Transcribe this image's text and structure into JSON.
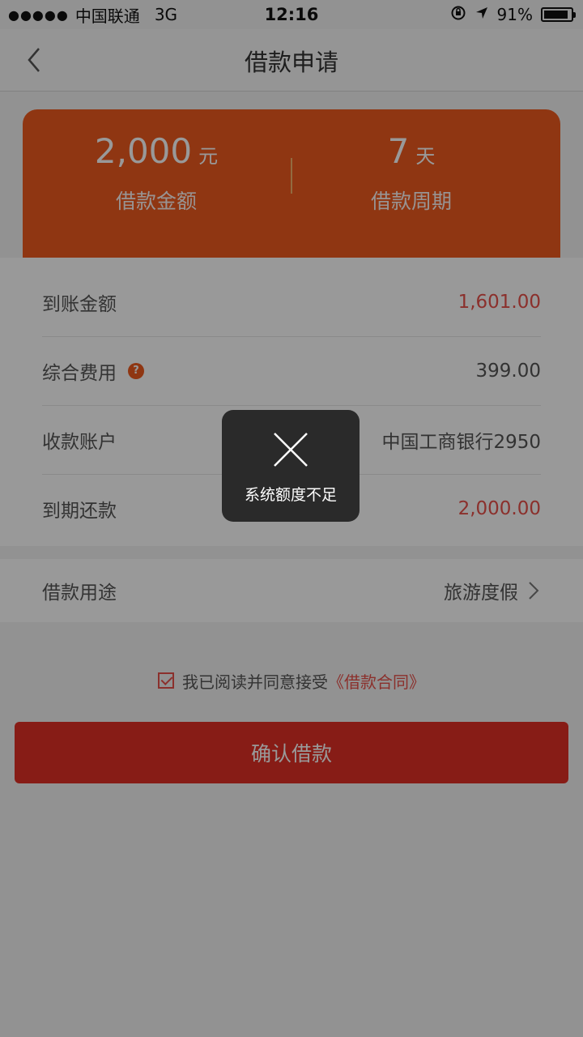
{
  "status_bar": {
    "signal_dots": "●●●●●",
    "carrier": "中国联通",
    "network": "3G",
    "time": "12:16",
    "battery_percent": "91%",
    "battery_level": 0.91,
    "icons": [
      "orientation-lock-icon",
      "location-arrow-icon",
      "battery-icon"
    ]
  },
  "nav": {
    "title": "借款申请",
    "back_icon": "chevron-left-icon"
  },
  "summary": {
    "amount": {
      "value": "2,000",
      "unit": "元",
      "label": "借款金额"
    },
    "period": {
      "value": "7",
      "unit": "天",
      "label": "借款周期"
    }
  },
  "details": [
    {
      "label": "到账金额",
      "value": "1,601.00"
    },
    {
      "label": "综合费用",
      "help": "?",
      "value": "399.00"
    },
    {
      "label": "收款账户",
      "value": "中国工商银行2950"
    },
    {
      "label": "到期还款",
      "value": "2,000.00"
    }
  ],
  "purpose": {
    "label": "借款用途",
    "value": "旅游度假"
  },
  "agreement": {
    "checked": true,
    "text": "我已阅读并同意接受",
    "link": "《借款合同》"
  },
  "confirm_button": "确认借款",
  "toast": {
    "icon": "close-icon",
    "message": "系统额度不足"
  },
  "colors": {
    "accent_orange": "#ee5a1f",
    "accent_red": "#e12f25",
    "value_red": "#e8504a"
  }
}
